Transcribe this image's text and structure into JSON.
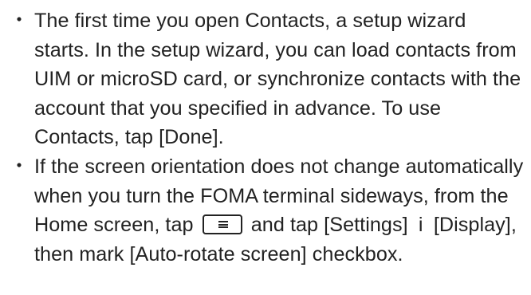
{
  "notes": {
    "bullet": "・",
    "item1": {
      "text": "The first time you open Contacts, a setup wizard starts. In the setup wizard, you can load contacts from UIM or microSD card, or synchronize contacts with the account that you specified in advance. To use Contacts, tap [Done]."
    },
    "item2": {
      "text_before_key": "If the screen orientation does not change automatically when you turn the FOMA terminal sideways, from the Home screen, tap",
      "key_icon": "menu-key-icon",
      "text_after_key": "and tap [Settings]",
      "arrow": "i",
      "text_end": "[Display], then mark [Auto-rotate screen] checkbox."
    }
  }
}
